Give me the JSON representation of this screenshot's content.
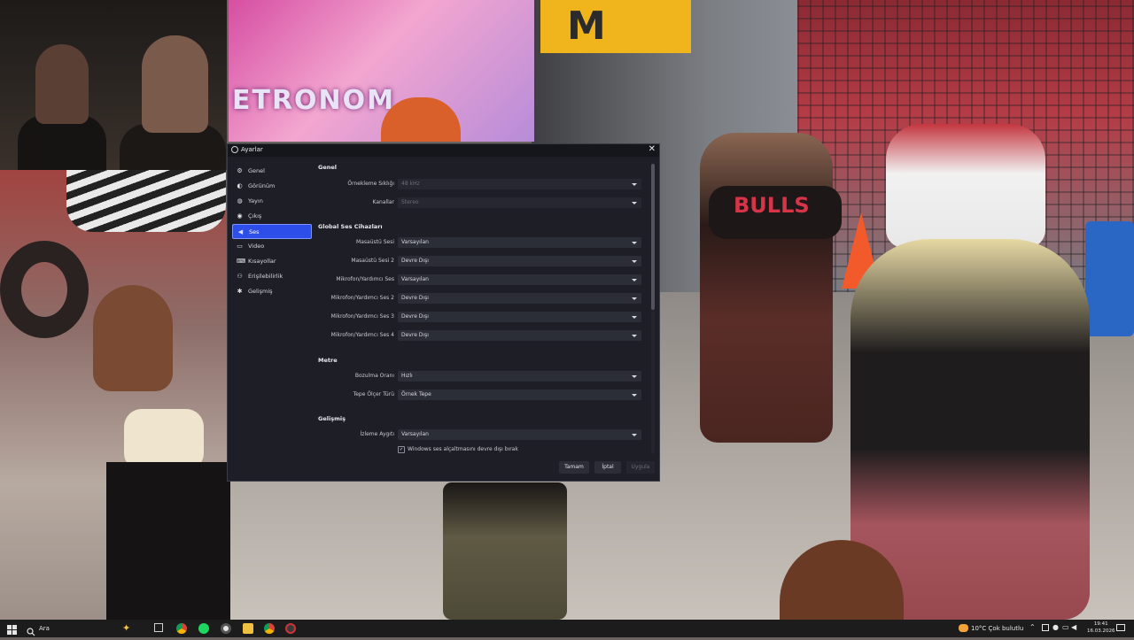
{
  "background": {
    "sign_text": "ETRONOM",
    "yellow_sign_text": "M",
    "dancer_shirt_text": "BULLS"
  },
  "dialog": {
    "title": "Ayarlar",
    "close_glyph": "✕",
    "sidebar": [
      {
        "label": "Genel",
        "icon": "gear-icon",
        "glyph": "⚙"
      },
      {
        "label": "Görünüm",
        "icon": "appearance-icon",
        "glyph": "◐"
      },
      {
        "label": "Yayın",
        "icon": "globe-icon",
        "glyph": "◍"
      },
      {
        "label": "Çıkış",
        "icon": "output-icon",
        "glyph": "◉"
      },
      {
        "label": "Ses",
        "icon": "speaker-icon",
        "glyph": "◀"
      },
      {
        "label": "Video",
        "icon": "monitor-icon",
        "glyph": "▭"
      },
      {
        "label": "Kısayollar",
        "icon": "keyboard-icon",
        "glyph": "⌨"
      },
      {
        "label": "Erişilebilirlik",
        "icon": "accessibility-icon",
        "glyph": "⚇"
      },
      {
        "label": "Gelişmiş",
        "icon": "wrench-icon",
        "glyph": "✱"
      }
    ],
    "active_index": 4,
    "sections": {
      "general": {
        "title": "Genel",
        "sample_rate_label": "Örnekleme Sıklığı",
        "sample_rate_value": "48 kHz",
        "channels_label": "Kanallar",
        "channels_value": "Stereo"
      },
      "global_devices": {
        "title": "Global Ses Cihazları",
        "rows": [
          {
            "label": "Masaüstü Sesi",
            "value": "Varsayılan"
          },
          {
            "label": "Masaüstü Sesi 2",
            "value": "Devre Dışı"
          },
          {
            "label": "Mikrofon/Yardımcı Ses",
            "value": "Varsayılan"
          },
          {
            "label": "Mikrofon/Yardımcı Ses 2",
            "value": "Devre Dışı"
          },
          {
            "label": "Mikrofon/Yardımcı Ses 3",
            "value": "Devre Dışı"
          },
          {
            "label": "Mikrofon/Yardımcı Ses 4",
            "value": "Devre Dışı"
          }
        ]
      },
      "meters": {
        "title": "Metre",
        "rows": [
          {
            "label": "Bozulma Oranı",
            "value": "Hızlı"
          },
          {
            "label": "Tepe Ölçer Türü",
            "value": "Örnek Tepe"
          }
        ]
      },
      "advanced": {
        "title": "Gelişmiş",
        "monitor_label": "İzleme Aygıtı",
        "monitor_value": "Varsayılan",
        "checkbox_label": "Windows ses alçaltmasını devre dışı bırak",
        "checkbox_checked": true
      }
    },
    "buttons": {
      "ok": "Tamam",
      "cancel": "İptal",
      "apply": "Uygula"
    }
  },
  "taskbar": {
    "search_text": "Ara",
    "weather": "10°C  Çok bulutlu",
    "time": "19:41",
    "date": "16.03.2026"
  }
}
